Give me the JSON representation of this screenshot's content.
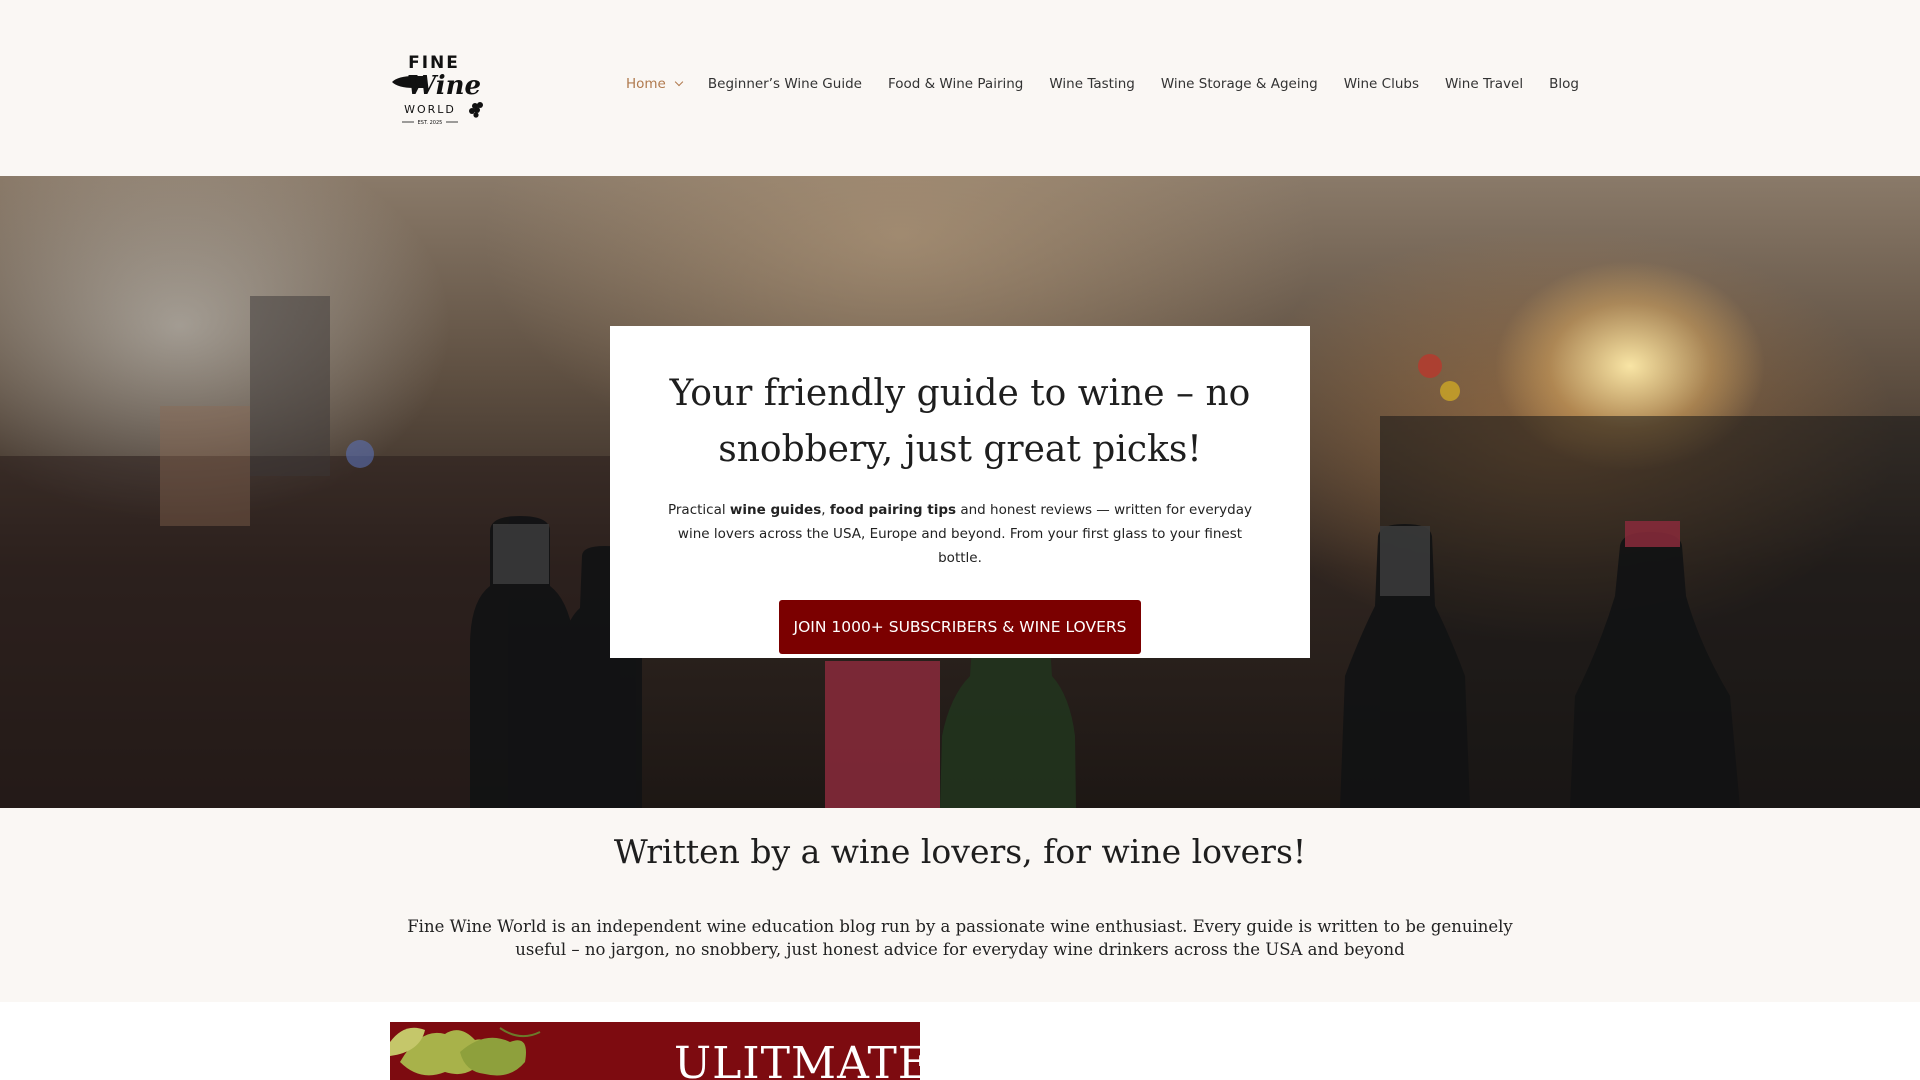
{
  "header": {
    "logo_alt": "Fine Wine World",
    "logo_text": {
      "line1": "FINE",
      "line2": "Wine",
      "line3": "WORLD",
      "line4": "EST. 2025"
    },
    "nav": [
      {
        "label": "Home",
        "active": true,
        "has_dropdown": true
      },
      {
        "label": "Beginner’s Wine Guide"
      },
      {
        "label": "Food & Wine Pairing"
      },
      {
        "label": "Wine Tasting"
      },
      {
        "label": "Wine Storage & Ageing"
      },
      {
        "label": "Wine Clubs"
      },
      {
        "label": "Wine Travel"
      },
      {
        "label": "Blog"
      }
    ]
  },
  "hero": {
    "title": "Your friendly guide to wine – no snobbery, just great picks!",
    "text_prefix": "Practical ",
    "text_bold1": "wine guides",
    "text_sep": ", ",
    "text_bold2": "food pairing tips",
    "text_suffix": " and honest reviews — written for everyday wine lovers across the USA, Europe and beyond. From your first glass to your finest bottle.",
    "cta_label": "JOIN 1000+ SUBSCRIBERS & WINE LOVERS"
  },
  "about": {
    "title": "Written by a wine lovers, for wine lovers!",
    "text": "Fine Wine World is an independent wine education blog run by a passionate wine enthusiast. Every guide is written to be genuinely useful – no jargon, no snobbery, just honest advice for everyday wine drinkers across the USA and beyond"
  },
  "promo": {
    "title": "ULITMATE"
  },
  "colors": {
    "accent": "#b07a4e",
    "cta": "#7b0000",
    "background": "#faf7f4",
    "promo": "#7d0b10"
  }
}
